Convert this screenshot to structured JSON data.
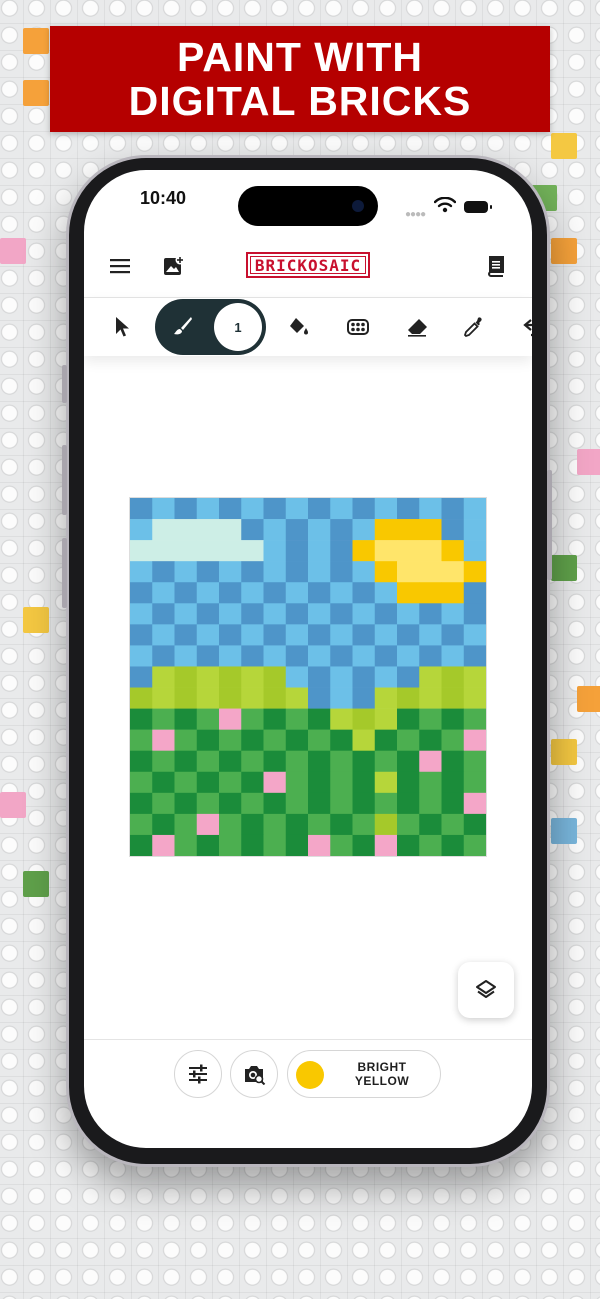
{
  "banner": {
    "line1": "PAINT WITH",
    "line2": "DIGITAL BRICKS"
  },
  "status": {
    "time": "10:40"
  },
  "header": {
    "logo": "BRICKOSAIC"
  },
  "toolbar": {
    "brush_size": "1"
  },
  "selected_color": {
    "name_line1": "BRIGHT",
    "name_line2": "YELLOW",
    "hex": "#f9c800"
  },
  "icons": {
    "menu": "menu-icon",
    "image": "add-image-icon",
    "instructions": "instructions-icon",
    "select": "cursor-icon",
    "brush": "brush-icon",
    "fill": "paint-bucket-icon",
    "texture": "brick-stamp-icon",
    "eraser": "eraser-icon",
    "picker": "eyedropper-icon",
    "undo": "undo-icon",
    "layers": "layers-icon",
    "settings": "sliders-icon",
    "camera": "camera-search-icon"
  },
  "palette": {
    "A": "#4e95c9",
    "a": "#6cc0e8",
    "C": "#cdeee6",
    "c": "#d9f3ee",
    "S": "#f9c800",
    "Y": "#ffe56a",
    "L": "#a5c92a",
    "l": "#b6d63a",
    "G": "#1b8c3a",
    "g": "#4caf50",
    "P": "#f4a6c8"
  },
  "mosaic": [
    "AaAaAaAaAaAaAaAa",
    "aCCCCAaAaAaSSSAa",
    "CCCCCCaAaASYYYSa",
    "aAaAaAaAaAaSYYYSA",
    "AaAaAaAaAaAaSSSAa",
    "aAaAaAaAaAaAaAaA",
    "AaAaAaAaAaAaAaAa",
    "aAaAaAaAaAaAaAaA",
    "AlLlLlLaAaAaAlLl",
    "LlLlLlLlAaAlLlLl",
    "GgGgPgGgGlLlGgGg",
    "gPgGgGgGgGlGgGgP",
    "GgGgGgGgGgGgGPGg",
    "gGgGgGPgGgGlGgGg",
    "GgGgGgGgGgGgGgGP",
    "gGgPgGgGgGgLgGgG",
    "GPgGgGgGPgGPGgGg"
  ]
}
